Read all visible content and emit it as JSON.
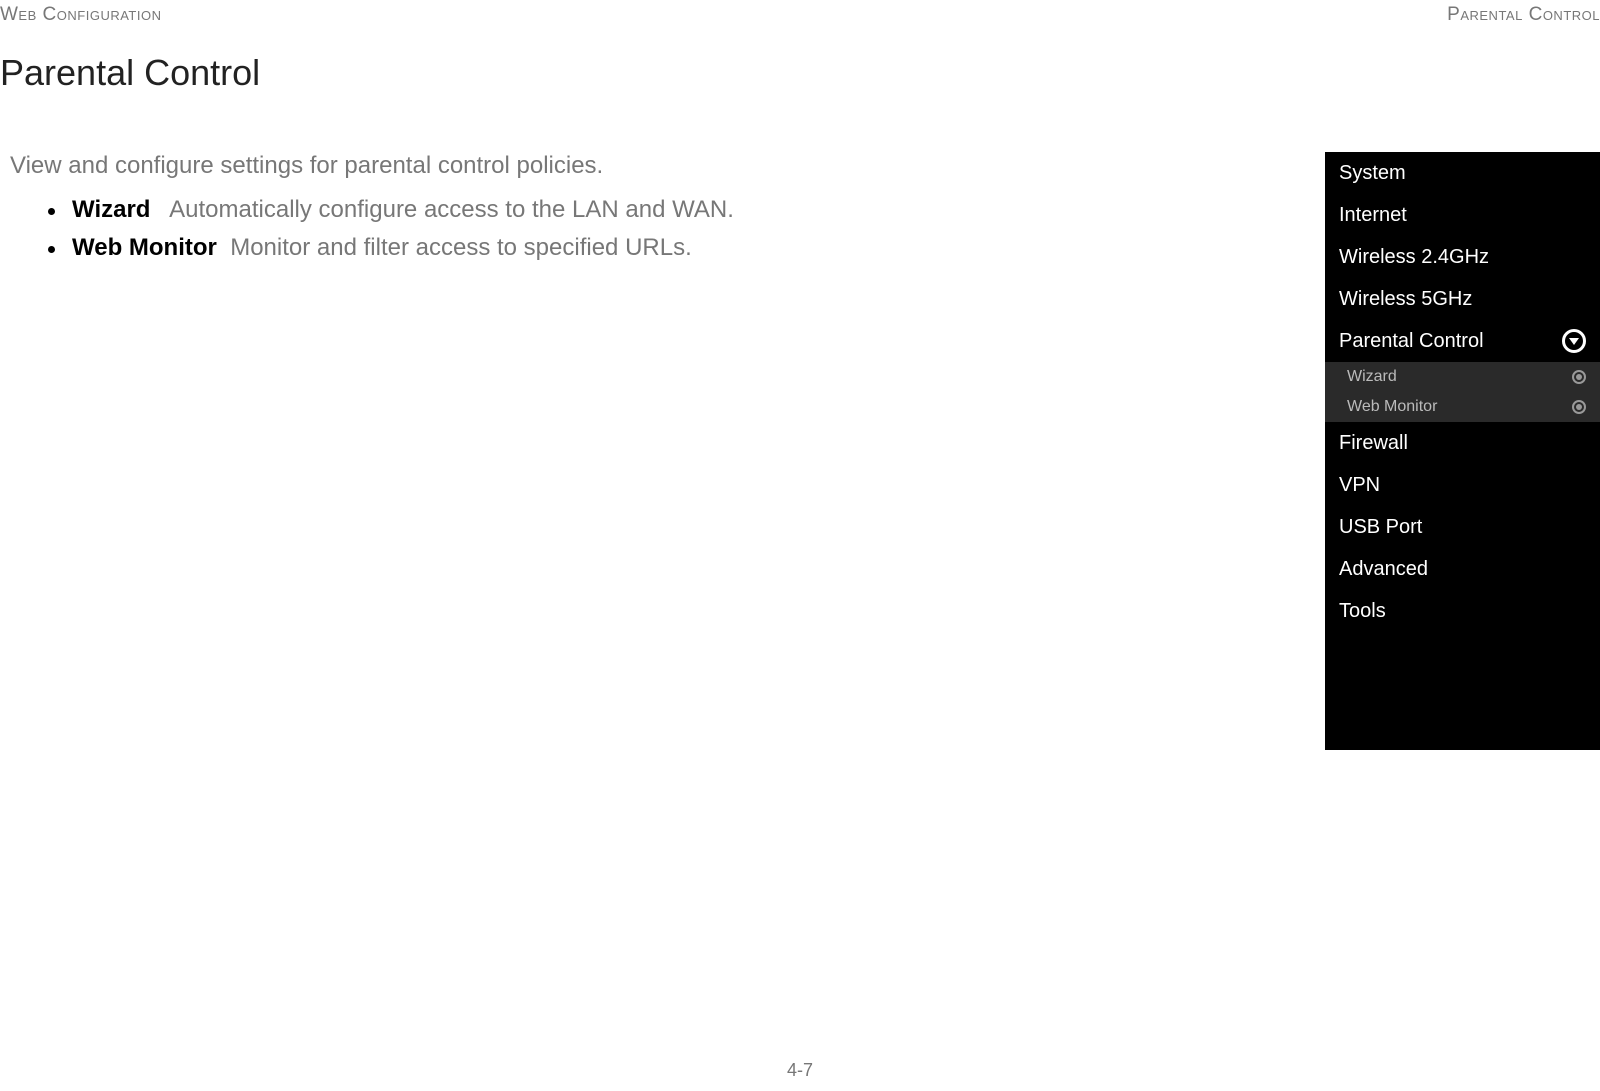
{
  "header": {
    "left": "Web Configuration",
    "right": "Parental Control"
  },
  "title": "Parental Control",
  "intro": "View and configure settings for parental control policies.",
  "features": [
    {
      "name": "Wizard",
      "desc": "Automatically configure access to the LAN and WAN."
    },
    {
      "name": "Web Monitor",
      "desc": "Monitor and filter access to specified URLs."
    }
  ],
  "sidebar": {
    "items": [
      {
        "label": "System"
      },
      {
        "label": "Internet"
      },
      {
        "label": "Wireless 2.4GHz"
      },
      {
        "label": "Wireless 5GHz"
      },
      {
        "label": "Parental Control",
        "expanded": true,
        "children": [
          {
            "label": "Wizard"
          },
          {
            "label": "Web Monitor"
          }
        ]
      },
      {
        "label": "Firewall"
      },
      {
        "label": "VPN"
      },
      {
        "label": "USB Port"
      },
      {
        "label": "Advanced"
      },
      {
        "label": "Tools"
      }
    ]
  },
  "page_number": "4-7"
}
